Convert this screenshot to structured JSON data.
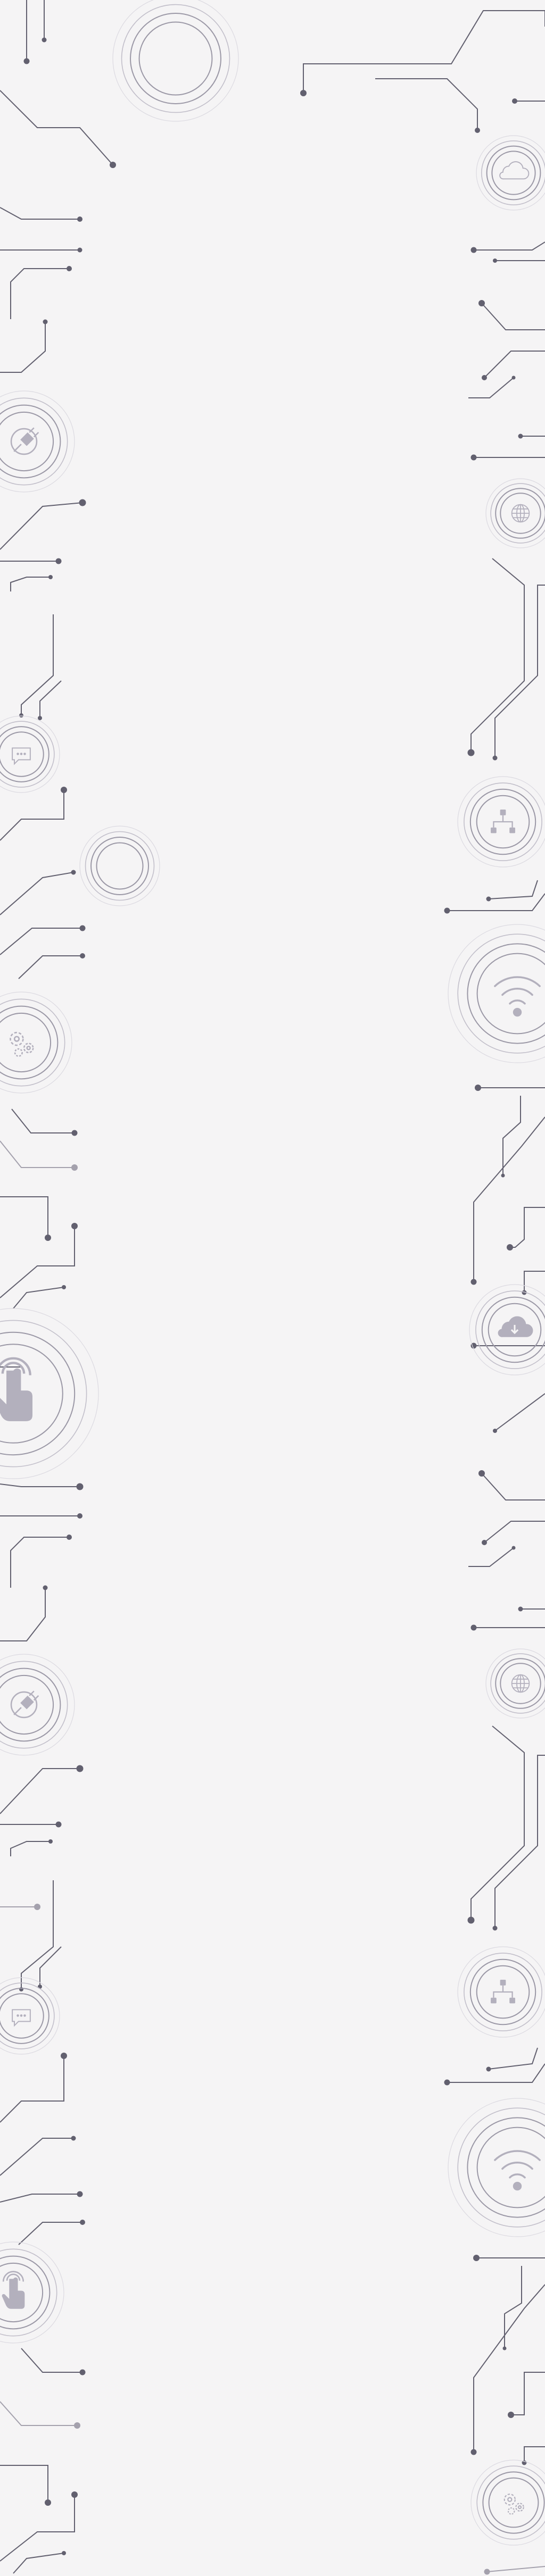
{
  "background": {
    "color": "#f5f4f5",
    "trace_color": "#62606f",
    "ring_color": "#9b98a6",
    "icon_color": "#b3b0bd"
  },
  "icons": [
    "cloud-icon",
    "plug-icon",
    "globe-icon",
    "chat-icon",
    "network-icon",
    "gears-icon",
    "wifi-icon",
    "cloud-download-icon",
    "touch-icon",
    "plug-icon",
    "globe-icon",
    "chat-icon",
    "network-icon",
    "wifi-icon",
    "touch-icon",
    "gears-icon"
  ]
}
